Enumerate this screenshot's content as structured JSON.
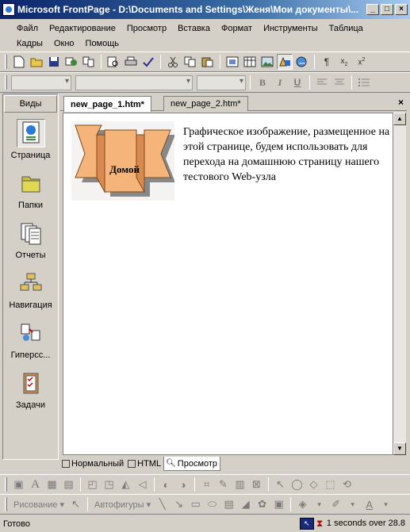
{
  "window": {
    "title": "Microsoft FrontPage - D:\\Documents and Settings\\Женя\\Мои документы\\...",
    "buttons": [
      "_",
      "□",
      "×"
    ]
  },
  "menu": {
    "row1": [
      "Файл",
      "Редактирование",
      "Просмотр",
      "Вставка",
      "Формат",
      "Инструменты",
      "Таблица"
    ],
    "row2": [
      "Кадры",
      "Окно",
      "Помощь"
    ]
  },
  "views": {
    "header": "Виды",
    "items": [
      {
        "label": "Страница",
        "icon": "page-view-icon"
      },
      {
        "label": "Папки",
        "icon": "folders-view-icon"
      },
      {
        "label": "Отчеты",
        "icon": "reports-view-icon"
      },
      {
        "label": "Навигация",
        "icon": "navigation-view-icon"
      },
      {
        "label": "Гиперсс...",
        "icon": "hyperlinks-view-icon"
      },
      {
        "label": "Задачи",
        "icon": "tasks-view-icon"
      }
    ]
  },
  "tabs": {
    "active": "new_page_1.htm*",
    "inactive": "new_page_2.htm*",
    "close": "×"
  },
  "page": {
    "button_label": "Домой",
    "text": "Графическое изображение, размещенное на этой странице, будем использовать для перехода на домашнюю страницу нашего тестового Web-узла"
  },
  "view_tabs": [
    "Нормальный",
    "HTML",
    "Просмотр"
  ],
  "drawing": {
    "draw_label": "Рисование",
    "autoshapes_label": "Автофигуры"
  },
  "status": {
    "left": "Готово",
    "timing": "1 seconds over 28.8"
  }
}
